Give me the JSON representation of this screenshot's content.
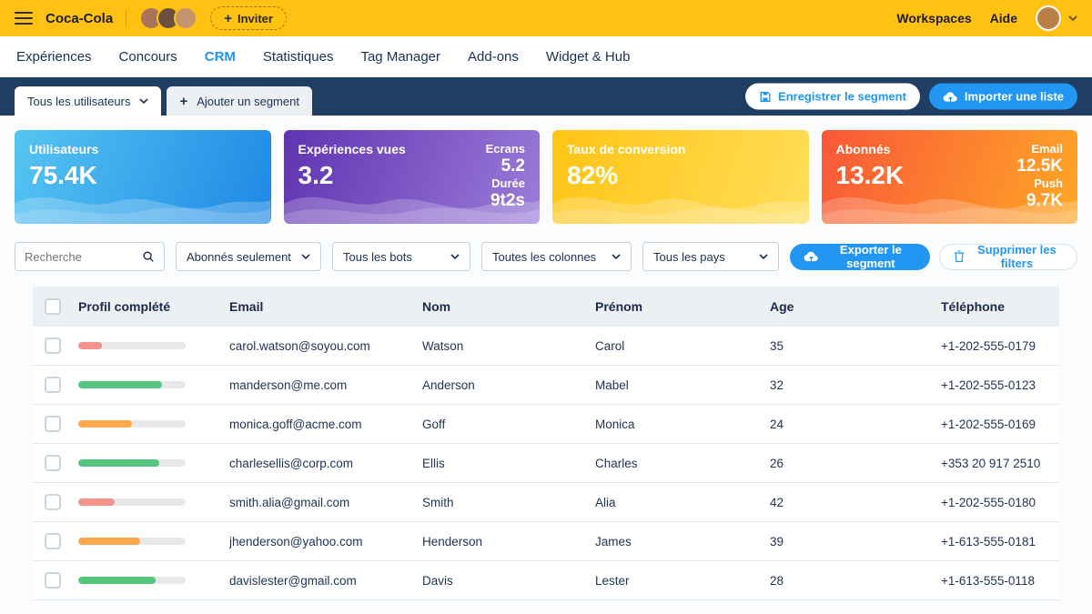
{
  "topbar": {
    "brand": "Coca-Cola",
    "invite_label": "Inviter",
    "workspaces_label": "Workspaces",
    "help_label": "Aide",
    "bg_color": "#FFC112"
  },
  "nav": {
    "active_color": "#2196F3",
    "items": [
      {
        "id": "experiences",
        "label": "Expériences",
        "active": false
      },
      {
        "id": "concours",
        "label": "Concours",
        "active": false
      },
      {
        "id": "crm",
        "label": "CRM",
        "active": true
      },
      {
        "id": "statistiques",
        "label": "Statistiques",
        "active": false
      },
      {
        "id": "tag-manager",
        "label": "Tag Manager",
        "active": false
      },
      {
        "id": "add-ons",
        "label": "Add-ons",
        "active": false
      },
      {
        "id": "widget-hub",
        "label": "Widget & Hub",
        "active": false
      }
    ]
  },
  "segment_bar": {
    "bg_color": "#203E63",
    "current_segment": "Tous les utilisateurs",
    "add_segment_label": "Ajouter un segment",
    "save_button": "Enregistrer le segment",
    "import_button": "Importer une liste"
  },
  "stats_cards": [
    {
      "id": "utilisateurs",
      "title": "Utilisateurs",
      "value": "75.4K",
      "gradient": [
        "#56C5F2",
        "#1E88E5"
      ],
      "side": []
    },
    {
      "id": "experiences-vues",
      "title": "Expériences vues",
      "value": "3.2",
      "gradient": [
        "#5F34B0",
        "#9B7BD9"
      ],
      "side": [
        {
          "label": "Ecrans",
          "value": "5.2"
        },
        {
          "label": "Durée",
          "value": "9t2s"
        }
      ]
    },
    {
      "id": "taux-conversion",
      "title": "Taux de conversion",
      "value": "82%",
      "gradient": [
        "#FFC415",
        "#FFDE59"
      ],
      "side": []
    },
    {
      "id": "abonnes",
      "title": "Abonnés",
      "value": "13.2K",
      "gradient": [
        "#F95738",
        "#FFA726"
      ],
      "side": [
        {
          "label": "Email",
          "value": "12.5K"
        },
        {
          "label": "Push",
          "value": "9.7K"
        }
      ]
    }
  ],
  "filters": {
    "search_placeholder": "Recherche",
    "dropdowns": [
      {
        "id": "abonnes-seulement",
        "value": "Abonnés seulement"
      },
      {
        "id": "bots",
        "value": "Tous les bots"
      },
      {
        "id": "colonnes",
        "value": "Toutes les colonnes"
      },
      {
        "id": "pays",
        "value": "Tous les pays"
      }
    ],
    "export_button": "Exporter le segment",
    "clear_button": "Supprimer les filters",
    "accent_color": "#2196F3"
  },
  "table": {
    "headers": [
      "Profil complété",
      "Email",
      "Nom",
      "Prénom",
      "Age",
      "Téléphone"
    ],
    "rows": [
      {
        "progress_pct": 22,
        "progress_color": "#F2938C",
        "email": "carol.watson@soyou.com",
        "nom": "Watson",
        "prenom": "Carol",
        "age": "35",
        "telephone": "+1-202-555-0179"
      },
      {
        "progress_pct": 78,
        "progress_color": "#55C57E",
        "email": "manderson@me.com",
        "nom": "Anderson",
        "prenom": "Mabel",
        "age": "32",
        "telephone": "+1-202-555-0123"
      },
      {
        "progress_pct": 50,
        "progress_color": "#FFA84D",
        "email": "monica.goff@acme.com",
        "nom": "Goff",
        "prenom": "Monica",
        "age": "24",
        "telephone": "+1-202-555-0169"
      },
      {
        "progress_pct": 75,
        "progress_color": "#55C57E",
        "email": "charlesellis@corp.com",
        "nom": "Ellis",
        "prenom": "Charles",
        "age": "26",
        "telephone": "+353 20 917 2510"
      },
      {
        "progress_pct": 34,
        "progress_color": "#F2938C",
        "email": "smith.alia@gmail.com",
        "nom": "Smith",
        "prenom": "Alia",
        "age": "42",
        "telephone": "+1-202-555-0180"
      },
      {
        "progress_pct": 58,
        "progress_color": "#FFA84D",
        "email": "jhenderson@yahoo.com",
        "nom": "Henderson",
        "prenom": "James",
        "age": "39",
        "telephone": "+1-613-555-0181"
      },
      {
        "progress_pct": 72,
        "progress_color": "#55C57E",
        "email": "davislester@gmail.com",
        "nom": "Davis",
        "prenom": "Lester",
        "age": "28",
        "telephone": "+1-613-555-0118"
      }
    ]
  }
}
